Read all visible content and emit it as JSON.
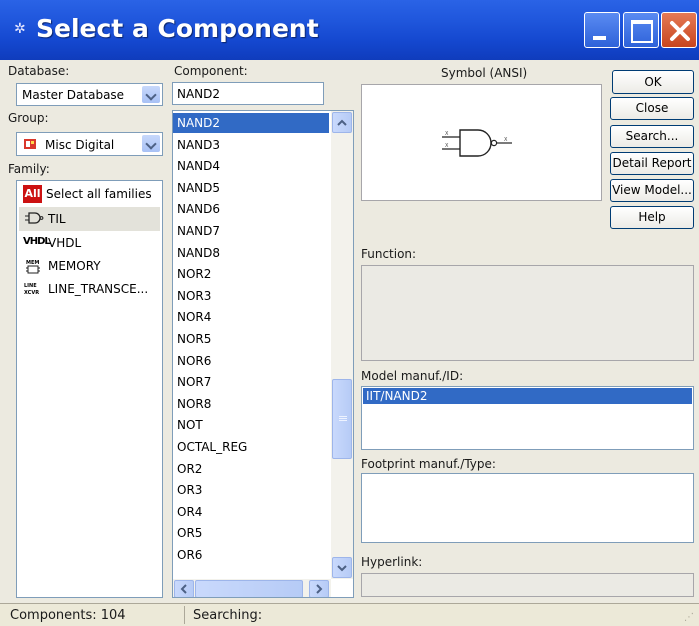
{
  "window": {
    "title": "Select a Component"
  },
  "database": {
    "label": "Database:",
    "value": "Master Database"
  },
  "group": {
    "label": "Group:",
    "value": "Misc Digital"
  },
  "family": {
    "label": "Family:",
    "items": [
      {
        "label": "Select all families",
        "icon": "all-badge",
        "selected": false
      },
      {
        "label": "TIL",
        "icon": "gate-icon",
        "selected": true
      },
      {
        "label": "VHDL",
        "icon": "vhdl-icon",
        "selected": false
      },
      {
        "label": "MEMORY",
        "icon": "memory-icon",
        "selected": false
      },
      {
        "label": "LINE_TRANSCE...",
        "icon": "line-transceiver-icon",
        "selected": false
      }
    ]
  },
  "component": {
    "label": "Component:",
    "value": "NAND2",
    "items": [
      "NAND2",
      "NAND3",
      "NAND4",
      "NAND5",
      "NAND6",
      "NAND7",
      "NAND8",
      "NOR2",
      "NOR3",
      "NOR4",
      "NOR5",
      "NOR6",
      "NOR7",
      "NOR8",
      "NOT",
      "OCTAL_REG",
      "OR2",
      "OR3",
      "OR4",
      "OR5",
      "OR6"
    ],
    "selected_index": 0
  },
  "symbol": {
    "label": "Symbol (ANSI)"
  },
  "buttons": {
    "ok": "OK",
    "close": "Close",
    "search": "Search...",
    "detail_report": "Detail Report",
    "view_model": "View Model...",
    "help": "Help"
  },
  "function": {
    "label": "Function:"
  },
  "model": {
    "label": "Model manuf./ID:",
    "selected": "IIT/NAND2"
  },
  "footprint": {
    "label": "Footprint manuf./Type:"
  },
  "hyperlink": {
    "label": "Hyperlink:"
  },
  "status": {
    "components": "Components: 104",
    "searching": "Searching:"
  },
  "colors": {
    "titlebar": "#1f56dc",
    "selection": "#316ac5",
    "dialog": "#eceae0"
  }
}
